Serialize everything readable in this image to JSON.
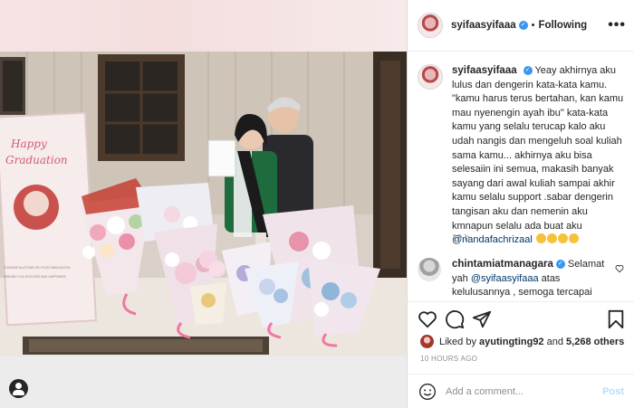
{
  "post": {
    "username": "syifaasyifaaa",
    "follow_state": "Following",
    "separator": "•",
    "more_label": "•••"
  },
  "caption": {
    "username": "syifaasyifaaa",
    "text": "Yeay akhirnya aku lulus dan dengerin kata-kata kamu. \"kamu harus terus bertahan, kan kamu mau nyenengin ayah ibu\" kata-kata kamu yang selalu terucap kalo aku udah nangis dan mengeluh soal kuliah sama kamu... akhirnya aku bisa selesaiin ini semua, makasih banyak sayang dari awal kuliah sampai akhir kamu selalu support .sabar dengerin tangisan aku dan nemenin aku kmnapun selalu ada buat aku",
    "mention": "@nandafachrizaal",
    "time": "10 h"
  },
  "comment": {
    "username": "chintamiatmanagara",
    "mention": "@syifaasyifaaa",
    "text_before": "Selamat yah",
    "text_after": "atas kelulusannya , semoga tercapai"
  },
  "likes": {
    "liked_by_prefix": "Liked by",
    "liker": "ayutingting92",
    "and": "and",
    "others": "5,268 others"
  },
  "timestamp": "10 HOURS AGO",
  "add_comment": {
    "placeholder": "Add a comment...",
    "post_label": "Post"
  },
  "photo_sign": {
    "title_line1": "Happy",
    "title_line2": "Graduation",
    "congrats": "CONGRATULATIONS ON YOUR GRADUATION",
    "wish": "WISHING YOU SUCCESS AND HAPPINESS"
  },
  "colors": {
    "verified": "#3897f0",
    "mention": "#00376b",
    "post_button_disabled": "#b2dffc",
    "meta_grey": "#8e8e8e"
  }
}
